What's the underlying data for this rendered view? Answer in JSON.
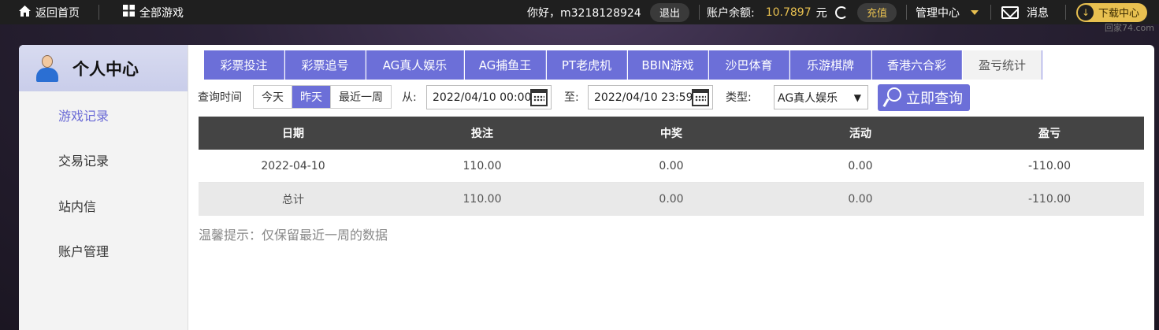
{
  "topbar": {
    "home_label": "返回首页",
    "all_games_label": "全部游戏",
    "greeting": "你好，m3218128924",
    "logout_label": "退出",
    "balance_label": "账户余额:",
    "balance_value": "10.7897",
    "balance_unit": "元",
    "recharge_label": "充值",
    "manage_label": "管理中心",
    "message_label": "消息",
    "download_label": "下载中心",
    "watermark": "回家74.com"
  },
  "sidebar": {
    "title": "个人中心",
    "items": [
      {
        "label": "游戏记录",
        "active": true
      },
      {
        "label": "交易记录",
        "active": false
      },
      {
        "label": "站内信",
        "active": false
      },
      {
        "label": "账户管理",
        "active": false
      }
    ]
  },
  "tabs": [
    {
      "label": "彩票投注"
    },
    {
      "label": "彩票追号"
    },
    {
      "label": "AG真人娱乐"
    },
    {
      "label": "AG捕鱼王"
    },
    {
      "label": "PT老虎机"
    },
    {
      "label": "BBIN游戏"
    },
    {
      "label": "沙巴体育"
    },
    {
      "label": "乐游棋牌"
    },
    {
      "label": "香港六合彩"
    },
    {
      "label": "盈亏统计",
      "active": true
    }
  ],
  "filters": {
    "query_time_label": "查询时间",
    "ranges": [
      "今天",
      "昨天",
      "最近一周"
    ],
    "active_range": "昨天",
    "from_label": "从:",
    "from_value": "2022/04/10 00:00",
    "to_label": "至:",
    "to_value": "2022/04/10 23:59",
    "type_label": "类型:",
    "type_value": "AG真人娱乐",
    "query_button": "立即查询"
  },
  "table": {
    "headers": [
      "日期",
      "投注",
      "中奖",
      "活动",
      "盈亏"
    ],
    "rows": [
      [
        "2022-04-10",
        "110.00",
        "0.00",
        "0.00",
        "-110.00"
      ]
    ],
    "total": [
      "总计",
      "110.00",
      "0.00",
      "0.00",
      "-110.00"
    ]
  },
  "hint": "温馨提示：仅保留最近一周的数据",
  "colors": {
    "accent": "#6c6fd8",
    "gold": "#e8c050",
    "table_header": "#444444"
  }
}
